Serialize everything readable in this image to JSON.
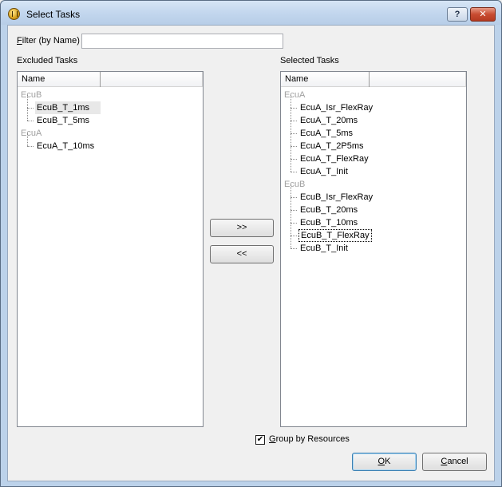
{
  "window": {
    "title": "Select Tasks",
    "help_label": "?",
    "close_label": "✕"
  },
  "filter": {
    "label_underlined": "F",
    "label_rest": "ilter (by Name)",
    "value": ""
  },
  "excluded": {
    "label": "Excluded Tasks",
    "header": "Name",
    "groups": [
      {
        "name": "EcuB",
        "items": [
          "EcuB_T_1ms",
          "EcuB_T_5ms"
        ]
      },
      {
        "name": "EcuA",
        "items": [
          "EcuA_T_10ms"
        ]
      }
    ]
  },
  "selected": {
    "label": "Selected Tasks",
    "header": "Name",
    "groups": [
      {
        "name": "EcuA",
        "items": [
          "EcuA_Isr_FlexRay",
          "EcuA_T_20ms",
          "EcuA_T_5ms",
          "EcuA_T_2P5ms",
          "EcuA_T_FlexRay",
          "EcuA_T_Init"
        ]
      },
      {
        "name": "EcuB",
        "items": [
          "EcuB_Isr_FlexRay",
          "EcuB_T_20ms",
          "EcuB_T_10ms",
          "EcuB_T_FlexRay",
          "EcuB_T_Init"
        ]
      }
    ]
  },
  "buttons": {
    "add_label": ">>",
    "remove_label": "<<",
    "ok_underlined": "O",
    "ok_rest": "K",
    "cancel_underlined": "C",
    "cancel_rest": "ancel"
  },
  "group_by": {
    "label_underlined": "G",
    "label_rest": "roup by Resources",
    "checked_mark": "✔"
  }
}
